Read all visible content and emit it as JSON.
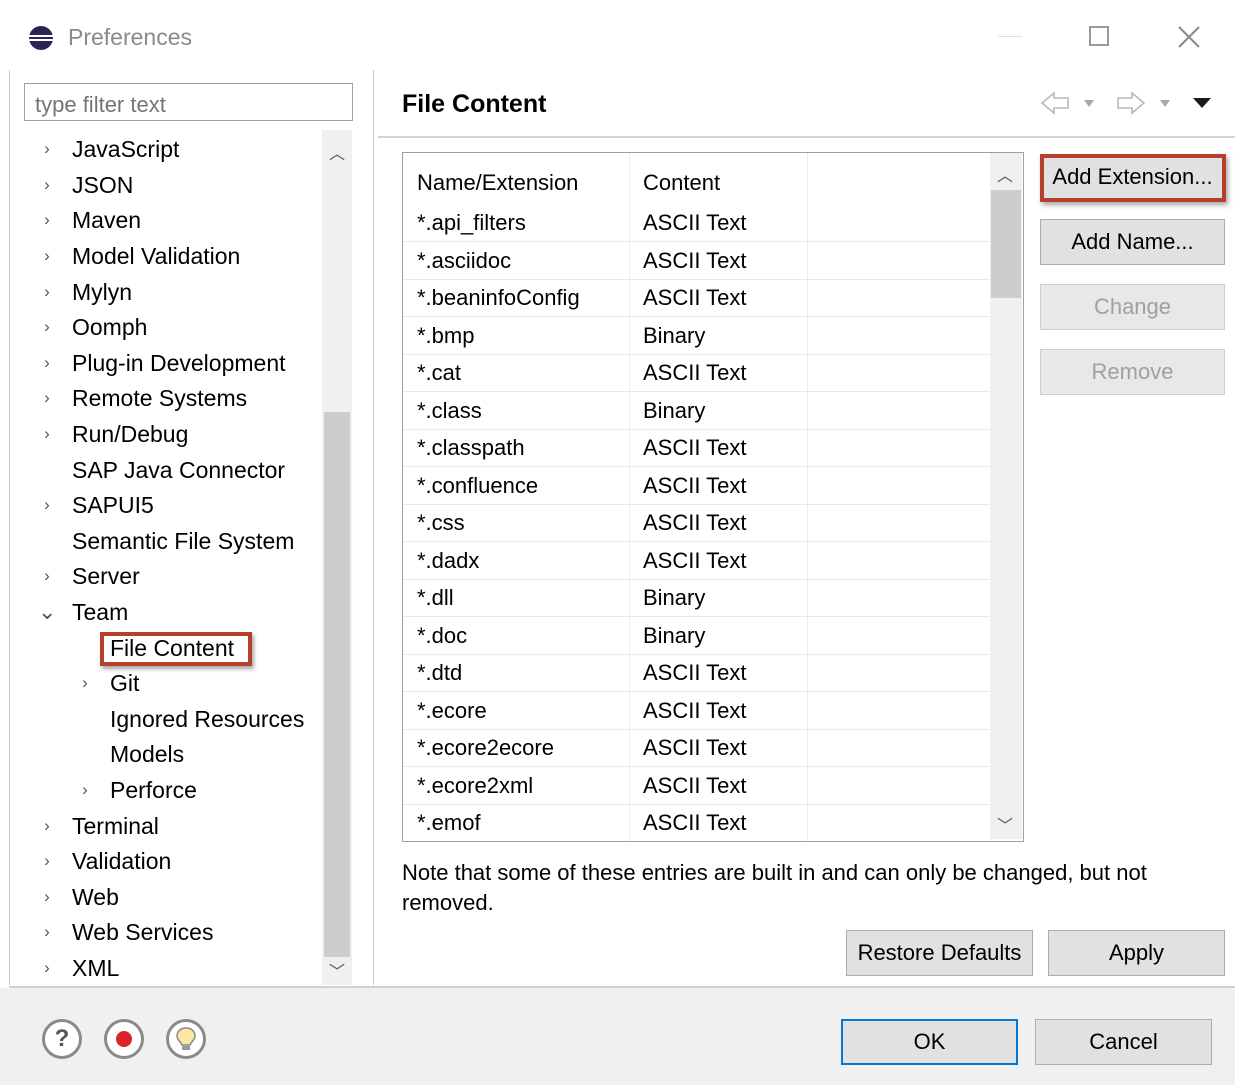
{
  "window": {
    "title": "Preferences"
  },
  "filter": {
    "placeholder": "type filter text"
  },
  "tree": {
    "items": [
      {
        "label": "JavaScript",
        "chevron": "›"
      },
      {
        "label": "JSON",
        "chevron": "›"
      },
      {
        "label": "Maven",
        "chevron": "›"
      },
      {
        "label": "Model Validation",
        "chevron": "›"
      },
      {
        "label": "Mylyn",
        "chevron": "›"
      },
      {
        "label": "Oomph",
        "chevron": "›"
      },
      {
        "label": "Plug-in Development",
        "chevron": "›"
      },
      {
        "label": "Remote Systems",
        "chevron": "›"
      },
      {
        "label": "Run/Debug",
        "chevron": "›"
      },
      {
        "label": "SAP Java Connector",
        "chevron": ""
      },
      {
        "label": "SAPUI5",
        "chevron": "›"
      },
      {
        "label": "Semantic File System",
        "chevron": ""
      },
      {
        "label": "Server",
        "chevron": "›"
      },
      {
        "label": "Team",
        "chevron": "⌄"
      },
      {
        "label": "File Content",
        "chevron": ""
      },
      {
        "label": "Git",
        "chevron": "›"
      },
      {
        "label": "Ignored Resources",
        "chevron": ""
      },
      {
        "label": "Models",
        "chevron": ""
      },
      {
        "label": "Perforce",
        "chevron": "›"
      },
      {
        "label": "Terminal",
        "chevron": "›"
      },
      {
        "label": "Validation",
        "chevron": "›"
      },
      {
        "label": "Web",
        "chevron": "›"
      },
      {
        "label": "Web Services",
        "chevron": "›"
      },
      {
        "label": "XML",
        "chevron": "›"
      }
    ]
  },
  "page": {
    "title": "File Content",
    "note": "Note that some of these entries are built in and can only be changed, but not removed."
  },
  "table": {
    "headers": [
      "Name/Extension",
      "Content"
    ],
    "rows": [
      [
        "*.api_filters",
        "ASCII Text"
      ],
      [
        "*.asciidoc",
        "ASCII Text"
      ],
      [
        "*.beaninfoConfig",
        "ASCII Text"
      ],
      [
        "*.bmp",
        "Binary"
      ],
      [
        "*.cat",
        "ASCII Text"
      ],
      [
        "*.class",
        "Binary"
      ],
      [
        "*.classpath",
        "ASCII Text"
      ],
      [
        "*.confluence",
        "ASCII Text"
      ],
      [
        "*.css",
        "ASCII Text"
      ],
      [
        "*.dadx",
        "ASCII Text"
      ],
      [
        "*.dll",
        "Binary"
      ],
      [
        "*.doc",
        "Binary"
      ],
      [
        "*.dtd",
        "ASCII Text"
      ],
      [
        "*.ecore",
        "ASCII Text"
      ],
      [
        "*.ecore2ecore",
        "ASCII Text"
      ],
      [
        "*.ecore2xml",
        "ASCII Text"
      ],
      [
        "*.emof",
        "ASCII Text"
      ]
    ]
  },
  "buttons": {
    "add_extension": "Add Extension...",
    "add_name": "Add Name...",
    "change": "Change",
    "remove": "Remove",
    "restore_defaults": "Restore Defaults",
    "apply": "Apply",
    "ok": "OK",
    "cancel": "Cancel"
  },
  "colors": {
    "highlight": "#b5402c",
    "button_bg": "#e1e1e1",
    "ok_border": "#0078d7"
  }
}
